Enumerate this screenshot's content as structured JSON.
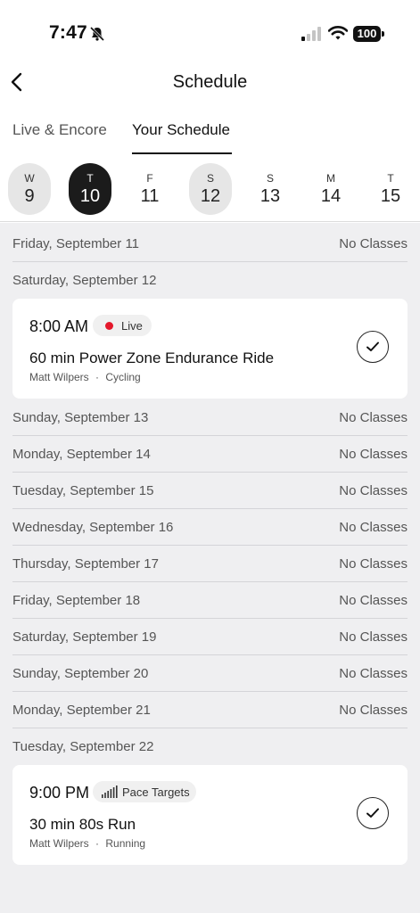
{
  "status_bar": {
    "time": "7:47",
    "battery": "100"
  },
  "header": {
    "title": "Schedule"
  },
  "tabs": [
    {
      "label": "Live & Encore"
    },
    {
      "label": "Your Schedule",
      "active": true
    }
  ],
  "days": [
    {
      "letter": "W",
      "number": "9"
    },
    {
      "letter": "T",
      "number": "10"
    },
    {
      "letter": "F",
      "number": "11"
    },
    {
      "letter": "S",
      "number": "12"
    },
    {
      "letter": "S",
      "number": "13"
    },
    {
      "letter": "M",
      "number": "14"
    },
    {
      "letter": "T",
      "number": "15"
    }
  ],
  "no_classes_label": "No Classes",
  "rows": [
    "Friday, September 11",
    "Saturday, September 12",
    "Sunday, September 13",
    "Monday, September 14",
    "Tuesday, September 15",
    "Wednesday, September 16",
    "Thursday, September 17",
    "Friday, September 18",
    "Saturday, September 19",
    "Sunday, September 20",
    "Monday, September 21",
    "Tuesday, September 22"
  ],
  "classes": [
    {
      "time": "8:00 AM",
      "badge": "Live",
      "name": "60 min Power Zone Endurance Ride",
      "instructor": "Matt Wilpers",
      "separator": "·",
      "discipline": "Cycling"
    },
    {
      "time": "9:00 PM",
      "badge": "Pace Targets",
      "name": "30 min 80s Run",
      "instructor": "Matt Wilpers",
      "separator": "·",
      "discipline": "Running"
    }
  ],
  "colors": {
    "live_dot": "#e4182b",
    "selected_day": "#1b1b1b",
    "background": "#efeff1"
  }
}
